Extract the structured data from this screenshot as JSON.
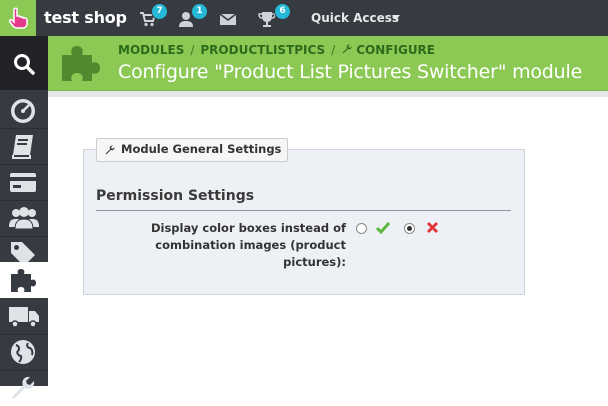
{
  "topbar": {
    "shop_name": "test shop",
    "badges": {
      "orders": "7",
      "customers": "1",
      "trophies": "6"
    },
    "quick_access_label": "Quick Access"
  },
  "icons": {
    "logo": "hand-pointer-icon",
    "orders": "cart-icon",
    "customers": "user-icon",
    "messages": "envelope-icon",
    "trophies": "trophy-icon",
    "sidebar": [
      "search-icon",
      "dashboard-icon",
      "book-icon",
      "credit-card-icon",
      "users-icon",
      "tags-icon",
      "puzzle-icon",
      "truck-icon",
      "globe-icon",
      "wrench-icon"
    ]
  },
  "header": {
    "breadcrumb": {
      "modules": "MODULES",
      "module_name": "PRODUCTLISTPICS",
      "configure": "CONFIGURE"
    },
    "title": "Configure \"Product List Pictures Switcher\" module"
  },
  "panel": {
    "legend": "Module General Settings",
    "section_title": "Permission Settings",
    "field_label": "Display color boxes instead of combination images (product pictures):",
    "selected_option": "no"
  },
  "colors": {
    "topbar_bg": "#363a41",
    "accent_green": "#8bc954",
    "badge_blue": "#25b9d7",
    "yes_icon": "#5bb83a",
    "no_icon": "#e0373b"
  }
}
